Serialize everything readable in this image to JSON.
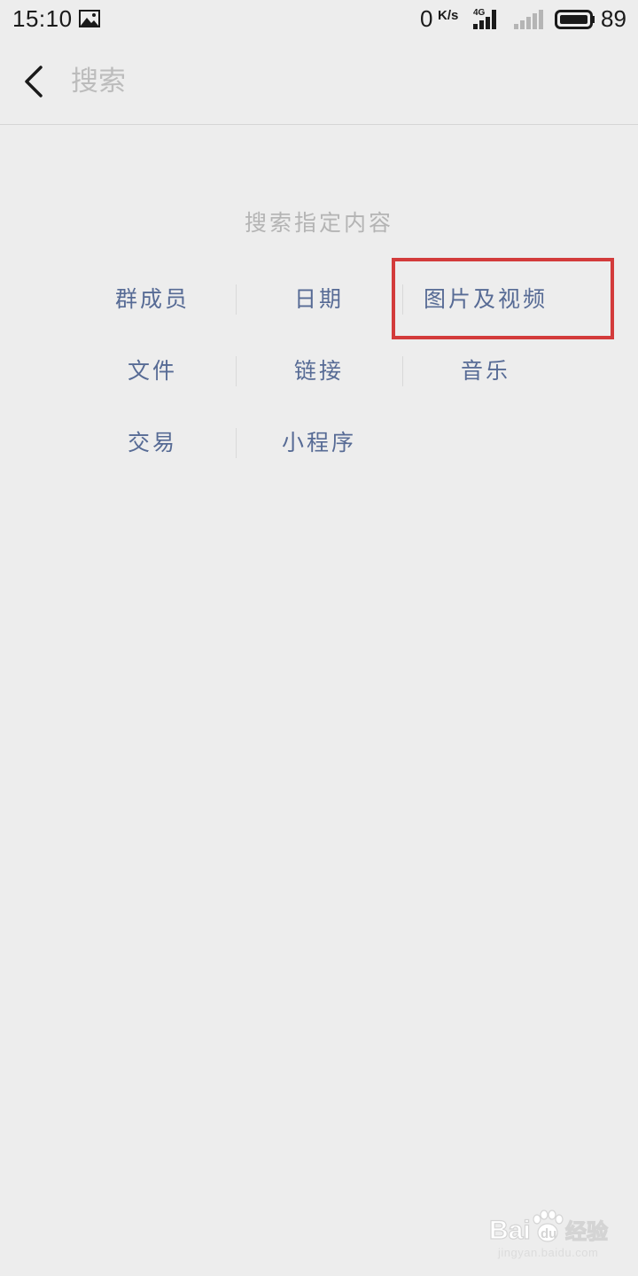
{
  "status_bar": {
    "time": "15:10",
    "net_speed": "0",
    "net_speed_unit": "K/s",
    "network_type": "4G",
    "battery_level": "89",
    "icons": [
      "image-icon",
      "signal-4g-icon",
      "signal-icon",
      "battery-icon"
    ]
  },
  "header": {
    "back_icon": "chevron-left-icon",
    "search_placeholder": "搜索"
  },
  "content": {
    "section_title": "搜索指定内容",
    "items": [
      {
        "label": "群成员"
      },
      {
        "label": "日期"
      },
      {
        "label": "图片及视频"
      },
      {
        "label": "文件"
      },
      {
        "label": "链接"
      },
      {
        "label": "音乐"
      },
      {
        "label": "交易"
      },
      {
        "label": "小程序"
      }
    ]
  },
  "annotation": {
    "highlighted_item": "图片及视频",
    "color": "#d33b3b"
  },
  "watermark": {
    "logo_text": "Bai du 经验",
    "url": "jingyan.baidu.com"
  },
  "colors": {
    "background": "#ededed",
    "link": "#576b95",
    "muted": "#b4b4b4"
  }
}
